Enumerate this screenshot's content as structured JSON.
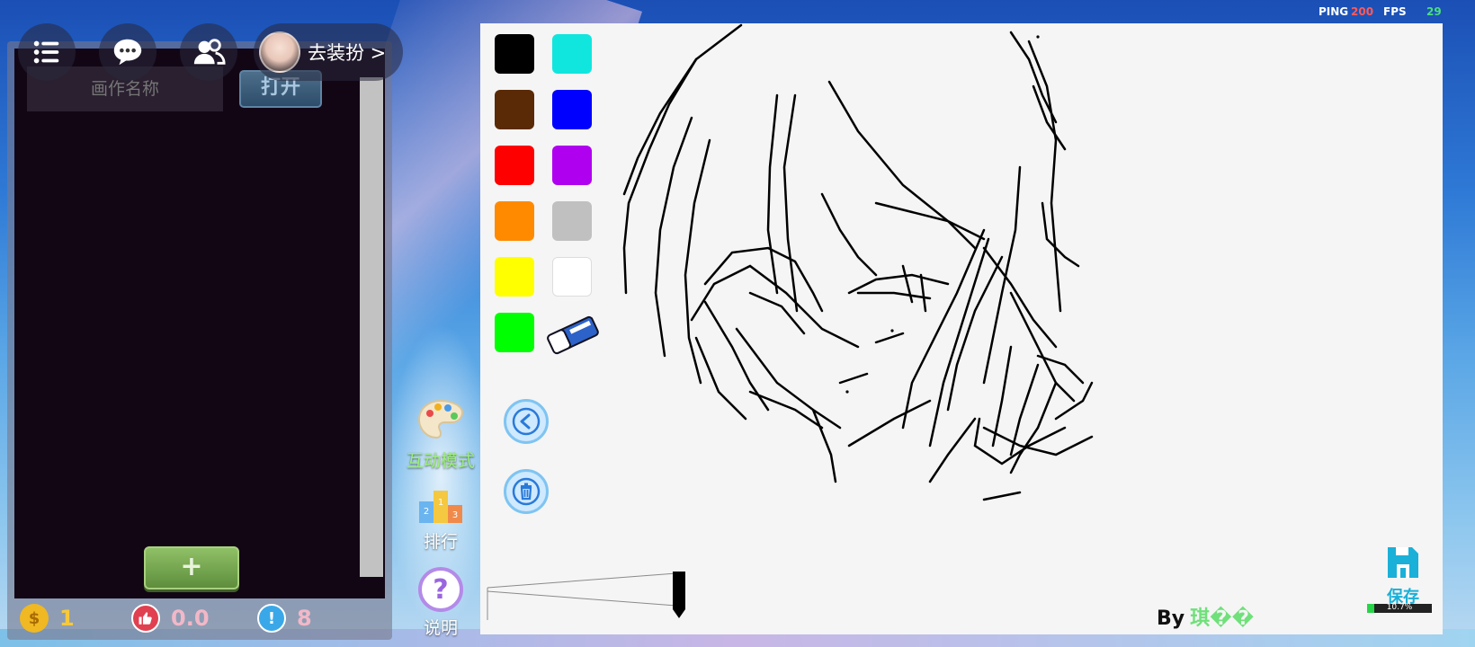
{
  "hud": {
    "ping_label": "PING",
    "ping_value": "200",
    "fps_label": "FPS",
    "fps_value": "29"
  },
  "top_bar": {
    "outfit_label": "去装扮 >"
  },
  "gallery": {
    "name_placeholder": "画作名称",
    "open_label": "打开",
    "add_label": "+",
    "stats": {
      "coins": "1",
      "likes": "0.0",
      "alerts": "8"
    }
  },
  "side_tools": [
    {
      "label": "互动模式",
      "icon": "palette-icon"
    },
    {
      "label": "排行",
      "icon": "podium-icon"
    },
    {
      "label": "说明",
      "icon": "question-icon"
    }
  ],
  "palette": {
    "colors": [
      "#000000",
      "#10e6de",
      "#5a2a06",
      "#0000ff",
      "#ff0000",
      "#b000f0",
      "#ff8a00",
      "#c0c0c0",
      "#ffff00",
      "#ffffff",
      "#00ff00"
    ]
  },
  "canvas": {
    "author_prefix": "By",
    "author_name": "琪��",
    "save_label": "保存",
    "progress_value": 0.107,
    "progress_label": "10.7%"
  },
  "colors": {
    "accent_green": "#6fe07a",
    "save_blue": "#1ab0d8",
    "ping_red": "#ff5a5a",
    "fps_green": "#4ade80"
  }
}
